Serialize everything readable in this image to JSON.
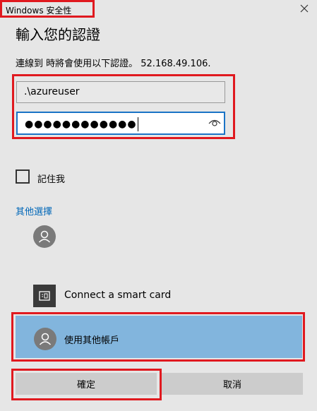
{
  "window": {
    "title": "Windows 安全性",
    "close_icon": "close-icon"
  },
  "dialog": {
    "heading": "輸入您的認證",
    "message": "連線到 時將會使用以下認證。 52.168.49.106."
  },
  "fields": {
    "username_value": ".\\azureuser",
    "password_masked": "●●●●●●●●●●●●",
    "reveal_icon": "eye-icon"
  },
  "options": {
    "remember_label": "記住我",
    "remember_checked": false,
    "more_choices_label": "其他選擇"
  },
  "accounts": [
    {
      "icon": "user-avatar-icon",
      "label": ""
    },
    {
      "icon": "smart-card-icon",
      "label": "Connect a smart card"
    },
    {
      "icon": "user-avatar-icon",
      "label": "使用其他帳戶",
      "selected": true
    }
  ],
  "buttons": {
    "ok_label": "確定",
    "cancel_label": "取消"
  },
  "colors": {
    "accent": "#0067b8",
    "selected_row": "#82b5dd",
    "highlight": "#e0191f",
    "background": "#e6e6e6"
  }
}
